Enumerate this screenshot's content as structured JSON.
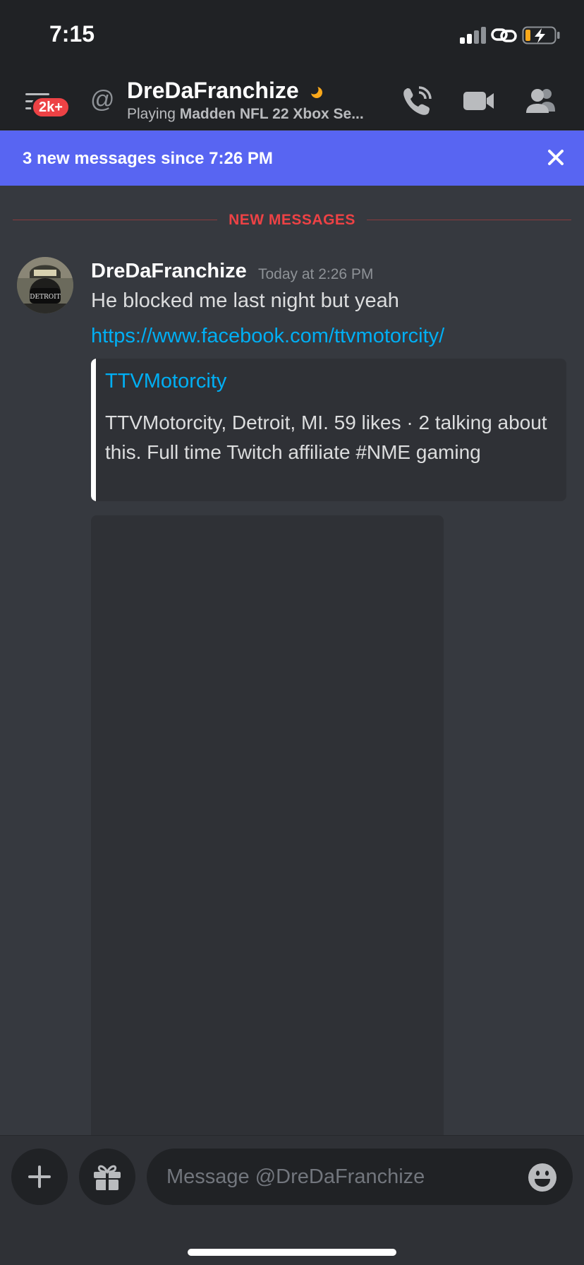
{
  "status_bar": {
    "time": "7:15"
  },
  "header": {
    "badge": "2k+",
    "at_symbol": "@",
    "name": "DreDaFranchize",
    "status_prefix": "Playing ",
    "status_game": "Madden NFL 22 Xbox Se..."
  },
  "new_messages_bar": {
    "text": "3 new messages since 7:26 PM"
  },
  "divider": {
    "label": "NEW MESSAGES"
  },
  "message": {
    "author": "DreDaFranchize",
    "timestamp": "Today at 2:26 PM",
    "text": "He blocked me last night but yeah",
    "link": "https://www.facebook.com/ttvmotorcity/",
    "embed": {
      "title": "TTVMotorcity",
      "description": "TTVMotorcity, Detroit, MI. 59 likes · 2 talking about this. Full time Twitch affiliate #NME gaming"
    }
  },
  "composer": {
    "placeholder": "Message @DreDaFranchize"
  },
  "colors": {
    "accent": "#5865f2",
    "link": "#00aff4",
    "danger": "#ed4245",
    "idle": "#faa81a",
    "background": "#36393f"
  },
  "icons": {
    "menu": "hamburger-icon",
    "call": "phone-call-icon",
    "video": "video-camera-icon",
    "members": "members-icon",
    "close": "close-icon",
    "add": "plus-icon",
    "gift": "gift-icon",
    "emoji": "emoji-icon"
  }
}
